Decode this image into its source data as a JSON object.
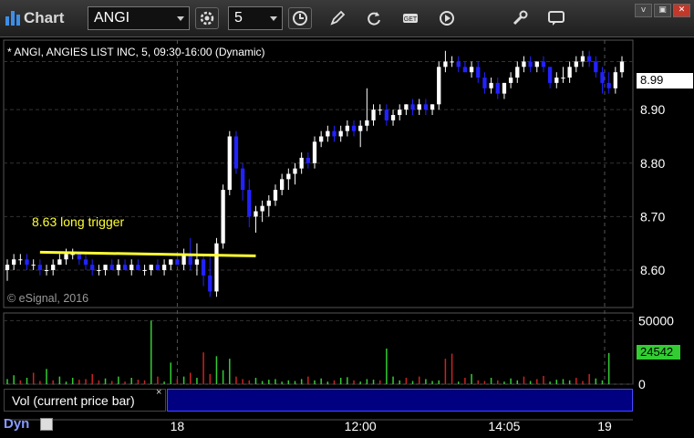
{
  "app": {
    "title": "Chart"
  },
  "toolbar": {
    "symbol": "ANGI",
    "interval": "5",
    "icons": [
      "settings-icon",
      "clock-icon",
      "pencil-icon",
      "refresh-icon",
      "get-icon",
      "play-icon",
      "tools-icon",
      "comment-icon"
    ]
  },
  "window": {
    "buttons": [
      "v",
      "▣",
      "✕"
    ]
  },
  "chart": {
    "title": "* ANGI, ANGIES LIST INC, 5, 09:30-16:00 (Dynamic)",
    "watermark": "© eSignal, 2016",
    "annotation": "8.63 long trigger",
    "last_price": "8.99",
    "price_ticks": [
      "8.90",
      "8.80",
      "8.70",
      "8.60"
    ],
    "vol_ticks": [
      "50000",
      "0"
    ],
    "vol_last": "24542",
    "time_ticks": [
      "18",
      "12:00",
      "14:05",
      "19"
    ],
    "study_label": "Vol (current price bar)",
    "study_close": "×",
    "mode": "Dyn"
  },
  "colors": {
    "up": "#ffffff",
    "down": "#2222ff",
    "annotation": "#ffff33",
    "vol_up": "#33cc33",
    "vol_down": "#cc2222"
  },
  "chart_data": {
    "type": "candlestick",
    "price_range": [
      8.53,
      9.03
    ],
    "trigger_level": 8.63,
    "bars": [
      [
        8.6,
        8.62,
        8.58,
        8.61
      ],
      [
        8.61,
        8.63,
        8.6,
        8.62
      ],
      [
        8.62,
        8.63,
        8.61,
        8.62
      ],
      [
        8.62,
        8.63,
        8.6,
        8.61
      ],
      [
        8.61,
        8.62,
        8.6,
        8.61
      ],
      [
        8.61,
        8.62,
        8.59,
        8.6
      ],
      [
        8.6,
        8.61,
        8.59,
        8.6
      ],
      [
        8.6,
        8.62,
        8.59,
        8.61
      ],
      [
        8.61,
        8.63,
        8.61,
        8.62
      ],
      [
        8.62,
        8.64,
        8.61,
        8.63
      ],
      [
        8.63,
        8.64,
        8.62,
        8.63
      ],
      [
        8.63,
        8.63,
        8.61,
        8.62
      ],
      [
        8.62,
        8.63,
        8.6,
        8.61
      ],
      [
        8.61,
        8.62,
        8.59,
        8.6
      ],
      [
        8.6,
        8.61,
        8.59,
        8.6
      ],
      [
        8.6,
        8.61,
        8.59,
        8.61
      ],
      [
        8.61,
        8.62,
        8.6,
        8.6
      ],
      [
        8.6,
        8.62,
        8.59,
        8.61
      ],
      [
        8.61,
        8.62,
        8.6,
        8.6
      ],
      [
        8.6,
        8.62,
        8.59,
        8.61
      ],
      [
        8.61,
        8.62,
        8.6,
        8.6
      ],
      [
        8.6,
        8.61,
        8.59,
        8.6
      ],
      [
        8.6,
        8.61,
        8.59,
        8.61
      ],
      [
        8.61,
        8.62,
        8.6,
        8.6
      ],
      [
        8.6,
        8.62,
        8.59,
        8.61
      ],
      [
        8.61,
        8.62,
        8.6,
        8.62
      ],
      [
        8.62,
        8.63,
        8.61,
        8.61
      ],
      [
        8.61,
        8.64,
        8.6,
        8.63
      ],
      [
        8.63,
        8.66,
        8.6,
        8.61
      ],
      [
        8.61,
        8.65,
        8.59,
        8.62
      ],
      [
        8.62,
        8.63,
        8.57,
        8.59
      ],
      [
        8.59,
        8.63,
        8.55,
        8.56
      ],
      [
        8.56,
        8.66,
        8.55,
        8.65
      ],
      [
        8.65,
        8.76,
        8.64,
        8.75
      ],
      [
        8.75,
        8.86,
        8.74,
        8.85
      ],
      [
        8.85,
        8.86,
        8.78,
        8.79
      ],
      [
        8.79,
        8.8,
        8.73,
        8.75
      ],
      [
        8.75,
        8.77,
        8.68,
        8.7
      ],
      [
        8.7,
        8.72,
        8.67,
        8.71
      ],
      [
        8.71,
        8.73,
        8.69,
        8.72
      ],
      [
        8.72,
        8.74,
        8.7,
        8.73
      ],
      [
        8.73,
        8.76,
        8.72,
        8.75
      ],
      [
        8.75,
        8.78,
        8.74,
        8.77
      ],
      [
        8.77,
        8.79,
        8.75,
        8.78
      ],
      [
        8.78,
        8.8,
        8.76,
        8.79
      ],
      [
        8.79,
        8.82,
        8.78,
        8.81
      ],
      [
        8.81,
        8.82,
        8.79,
        8.8
      ],
      [
        8.8,
        8.85,
        8.79,
        8.84
      ],
      [
        8.84,
        8.86,
        8.83,
        8.85
      ],
      [
        8.85,
        8.87,
        8.84,
        8.86
      ],
      [
        8.86,
        8.87,
        8.84,
        8.85
      ],
      [
        8.85,
        8.87,
        8.84,
        8.86
      ],
      [
        8.86,
        8.88,
        8.85,
        8.87
      ],
      [
        8.87,
        8.88,
        8.85,
        8.86
      ],
      [
        8.86,
        8.88,
        8.83,
        8.87
      ],
      [
        8.87,
        8.94,
        8.86,
        8.88
      ],
      [
        8.88,
        8.91,
        8.87,
        8.9
      ],
      [
        8.9,
        8.91,
        8.89,
        8.9
      ],
      [
        8.9,
        8.91,
        8.87,
        8.88
      ],
      [
        8.88,
        8.9,
        8.87,
        8.89
      ],
      [
        8.89,
        8.91,
        8.88,
        8.9
      ],
      [
        8.9,
        8.91,
        8.89,
        8.91
      ],
      [
        8.91,
        8.92,
        8.89,
        8.9
      ],
      [
        8.9,
        8.92,
        8.89,
        8.91
      ],
      [
        8.91,
        8.92,
        8.89,
        8.9
      ],
      [
        8.9,
        8.91,
        8.89,
        8.91
      ],
      [
        8.91,
        8.99,
        8.9,
        8.98
      ],
      [
        8.98,
        9.01,
        8.97,
        8.99
      ],
      [
        8.99,
        9.0,
        8.98,
        8.99
      ],
      [
        8.99,
        9.0,
        8.97,
        8.98
      ],
      [
        8.98,
        8.99,
        8.97,
        8.97
      ],
      [
        8.97,
        8.99,
        8.96,
        8.98
      ],
      [
        8.98,
        8.99,
        8.95,
        8.96
      ],
      [
        8.96,
        8.97,
        8.93,
        8.94
      ],
      [
        8.94,
        8.96,
        8.93,
        8.95
      ],
      [
        8.95,
        8.96,
        8.92,
        8.93
      ],
      [
        8.93,
        8.95,
        8.92,
        8.95
      ],
      [
        8.95,
        8.97,
        8.94,
        8.96
      ],
      [
        8.96,
        8.99,
        8.95,
        8.98
      ],
      [
        8.98,
        9.0,
        8.97,
        8.99
      ],
      [
        8.99,
        9.0,
        8.97,
        8.98
      ],
      [
        8.98,
        8.99,
        8.97,
        8.99
      ],
      [
        8.99,
        9.0,
        8.97,
        8.98
      ],
      [
        8.98,
        8.98,
        8.94,
        8.95
      ],
      [
        8.95,
        8.97,
        8.94,
        8.96
      ],
      [
        8.96,
        8.98,
        8.95,
        8.96
      ],
      [
        8.96,
        8.99,
        8.95,
        8.98
      ],
      [
        8.98,
        9.0,
        8.97,
        8.99
      ],
      [
        8.99,
        9.01,
        8.98,
        9.0
      ],
      [
        9.0,
        9.01,
        8.98,
        8.99
      ],
      [
        8.99,
        9.0,
        8.96,
        8.97
      ],
      [
        8.97,
        8.98,
        8.93,
        8.95
      ],
      [
        8.95,
        8.97,
        8.93,
        8.94
      ],
      [
        8.94,
        8.98,
        8.93,
        8.97
      ],
      [
        8.97,
        9.0,
        8.96,
        8.99
      ]
    ],
    "volume": [
      4000,
      7000,
      3000,
      5000,
      9000,
      2500,
      12000,
      3000,
      6000,
      2000,
      5000,
      3500,
      4000,
      8000,
      3000,
      4500,
      2500,
      6000,
      2000,
      5000,
      3500,
      3000,
      50000,
      6000,
      2000,
      17000,
      4000,
      6000,
      9000,
      5000,
      25000,
      8000,
      22000,
      11000,
      20000,
      6000,
      4000,
      3000,
      5000,
      2500,
      3500,
      4000,
      2000,
      3000,
      2500,
      4000,
      6000,
      3000,
      4500,
      2000,
      3000,
      5000,
      5500,
      3000,
      2000,
      4000,
      3500,
      3000,
      28000,
      6000,
      3000,
      5000,
      2500,
      6000,
      4000,
      2500,
      3000,
      20000,
      24000,
      2000,
      5000,
      8000,
      3000,
      2500,
      5000,
      3000,
      2000,
      4500,
      3000,
      6000,
      2500,
      4000,
      6500,
      2000,
      3500,
      4000,
      3000,
      5000,
      2500,
      8000,
      4500,
      3000,
      24542
    ],
    "volume_up": [
      true,
      true,
      false,
      true,
      false,
      false,
      true,
      false,
      true,
      true,
      true,
      false,
      false,
      false,
      false,
      true,
      false,
      true,
      false,
      true,
      false,
      false,
      true,
      false,
      true,
      true,
      false,
      true,
      false,
      true,
      false,
      false,
      true,
      true,
      true,
      false,
      false,
      false,
      true,
      true,
      true,
      true,
      true,
      true,
      true,
      true,
      false,
      true,
      true,
      true,
      false,
      true,
      true,
      false,
      true,
      true,
      true,
      false,
      true,
      true,
      true,
      false,
      true,
      false,
      true,
      true,
      true,
      false,
      false,
      true,
      false,
      true,
      false,
      false,
      true,
      false,
      true,
      true,
      true,
      false,
      true,
      false,
      false,
      true,
      true,
      true,
      true,
      false,
      false,
      false,
      true,
      true,
      true
    ],
    "volume_range": [
      0,
      56000
    ]
  }
}
